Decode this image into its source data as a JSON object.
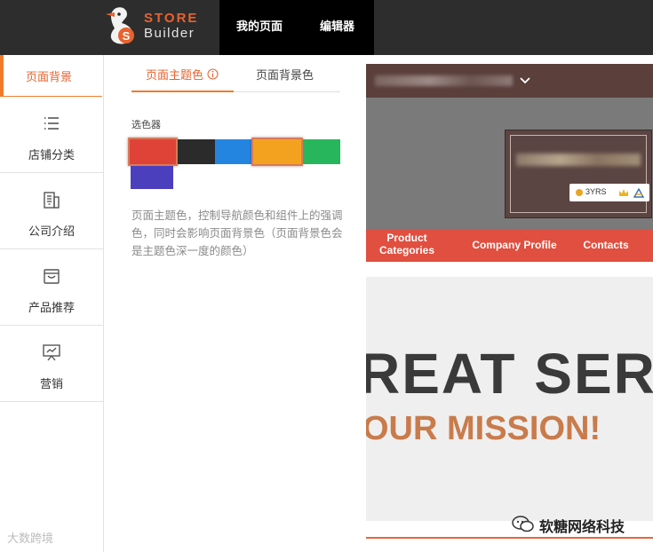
{
  "app": {
    "logo_line1": "STORE",
    "logo_line2": "Builder",
    "nav": [
      "我的页面",
      "编辑器"
    ]
  },
  "sidebar": {
    "active_label": "页面背景",
    "items": [
      {
        "label": "店铺分类",
        "icon": "list-icon"
      },
      {
        "label": "公司介绍",
        "icon": "building-icon"
      },
      {
        "label": "产品推荐",
        "icon": "shopping-bag-icon"
      },
      {
        "label": "营销",
        "icon": "presentation-icon"
      }
    ]
  },
  "panel": {
    "tabs": [
      "页面主题色",
      "页面背景色"
    ],
    "active_tab": "页面主题色",
    "info_icon": "info-icon",
    "picker_label": "选色器",
    "swatches": [
      "#df4338",
      "#2b2b2b",
      "#2485e0",
      "#f3a21f",
      "#27b65b",
      "#4b3fbe"
    ],
    "selected_swatches": [
      "#df4338",
      "#f3a21f"
    ],
    "description": "页面主题色，控制导航颜色和组件上的强调色，同时会影响页面背景色（页面背景色会是主题色深一度的颜色）"
  },
  "preview": {
    "badge_text": "3YRS",
    "nav": [
      "Product Categories",
      "Company Profile",
      "Contacts"
    ],
    "hero_title": "REAT SERV",
    "hero_subtitle": "OUR MISSION!"
  },
  "watermarks": {
    "left": "大数跨境",
    "right": "软糖网络科技"
  },
  "colors": {
    "accent": "#f07b2a",
    "topbar": "#2d2d2d",
    "preview_nav": "#e04f3f"
  }
}
